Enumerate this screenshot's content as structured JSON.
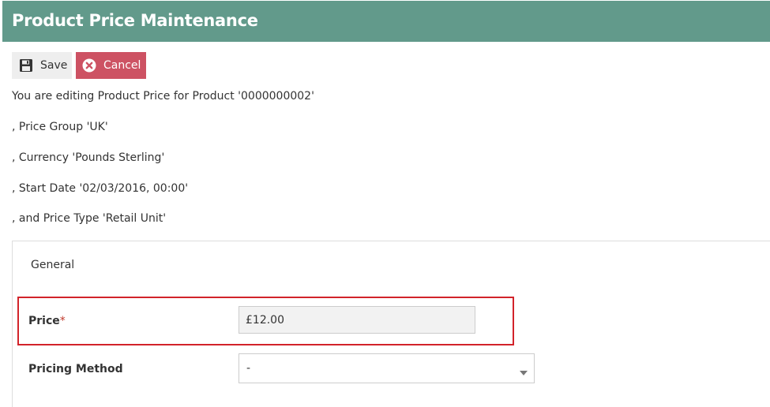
{
  "page": {
    "title": "Product Price Maintenance"
  },
  "toolbar": {
    "save_label": "Save",
    "cancel_label": "Cancel"
  },
  "intro": [
    "You are editing Product Price for Product '0000000002'",
    ", Price Group 'UK'",
    ", Currency 'Pounds Sterling'",
    ", Start Date '02/03/2016, 00:00'",
    ", and Price Type 'Retail Unit'"
  ],
  "panel": {
    "title": "General",
    "price": {
      "label": "Price",
      "required_marker": "*",
      "value": "£12.00"
    },
    "pricing_method": {
      "label": "Pricing Method",
      "value": "-"
    }
  },
  "colors": {
    "header": "#629a8b",
    "cancel": "#cd5263",
    "highlight": "#d2232a"
  },
  "icons": {
    "save": "floppy-disk-icon",
    "cancel": "times-circle-icon",
    "select": "caret-down-icon"
  }
}
